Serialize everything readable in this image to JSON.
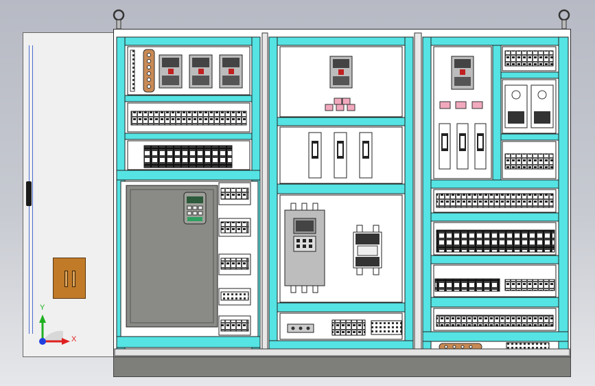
{
  "viewport": {
    "background_top": "#b7bac4",
    "background_bottom": "#e6e7ea"
  },
  "colors": {
    "cyan_rail": "#55e3e3",
    "cabinet_white": "#ffffff",
    "outline": "#2a2a2a",
    "drive_gray": "#8a8b86",
    "plinth_gray": "#7e7f7b",
    "door_panel": "#f0f0f0",
    "handle_brown": "#c07a28",
    "pink_block": "#f2a9bd",
    "axis_x": "#e02020",
    "axis_y": "#20b020",
    "axis_z": "#2040e0"
  },
  "triad": {
    "x_label": "X",
    "y_label": "Y"
  },
  "icons": {
    "lifting_eye": "lifting-eye-icon",
    "triad": "coordinate-triad-icon"
  }
}
